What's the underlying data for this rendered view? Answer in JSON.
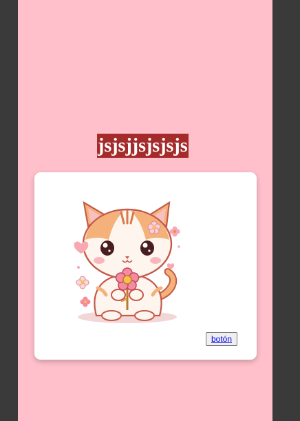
{
  "page": {
    "heading": "jsjsjjsjsjsjs",
    "background_color": "#ffc0cb",
    "heading_bg_color": "#a52a2a"
  },
  "card": {
    "image_icon": "cat-holding-flower-illustration",
    "button_label": "botón"
  }
}
